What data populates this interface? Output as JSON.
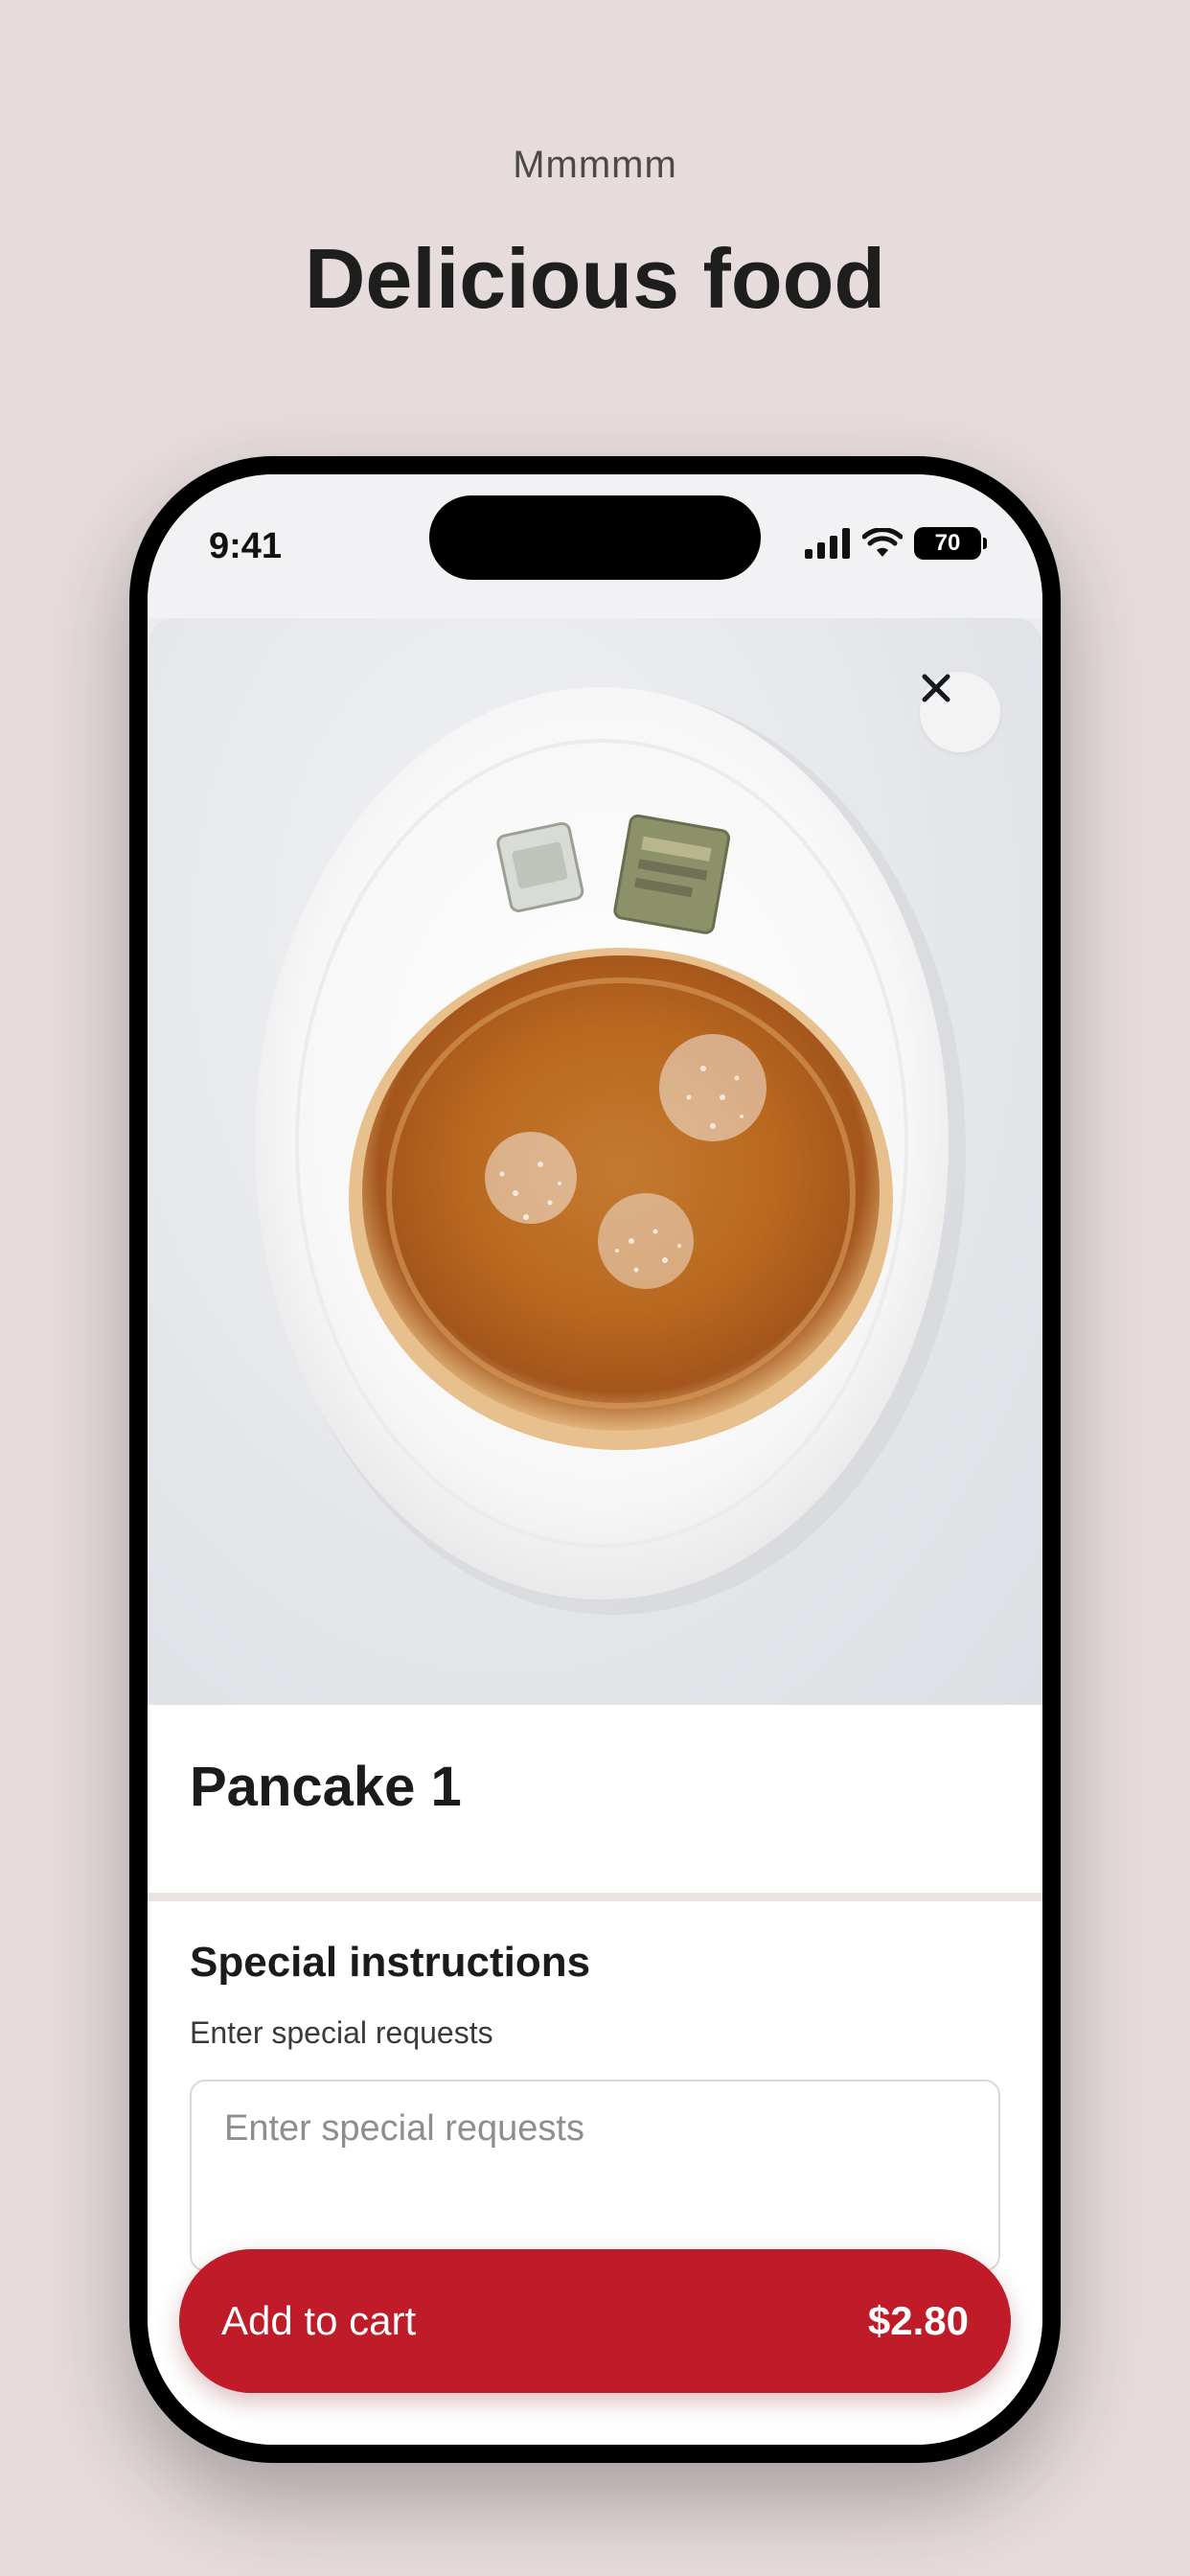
{
  "promo": {
    "eyebrow": "Mmmmm",
    "headline": "Delicious food"
  },
  "status_bar": {
    "time": "9:41",
    "battery": "70",
    "icons": [
      "signal-icon",
      "wifi-icon",
      "battery-icon"
    ]
  },
  "item": {
    "title": "Pancake 1",
    "image_alt_icon": "pancake-photo"
  },
  "instructions": {
    "title": "Special instructions",
    "subtitle": "Enter special requests",
    "placeholder": "Enter special requests",
    "value": ""
  },
  "cart_button": {
    "label": "Add to cart",
    "price": "$2.80"
  },
  "colors": {
    "background": "#e6dcdc",
    "accent": "#bf1b29",
    "text": "#1e1e1e"
  }
}
